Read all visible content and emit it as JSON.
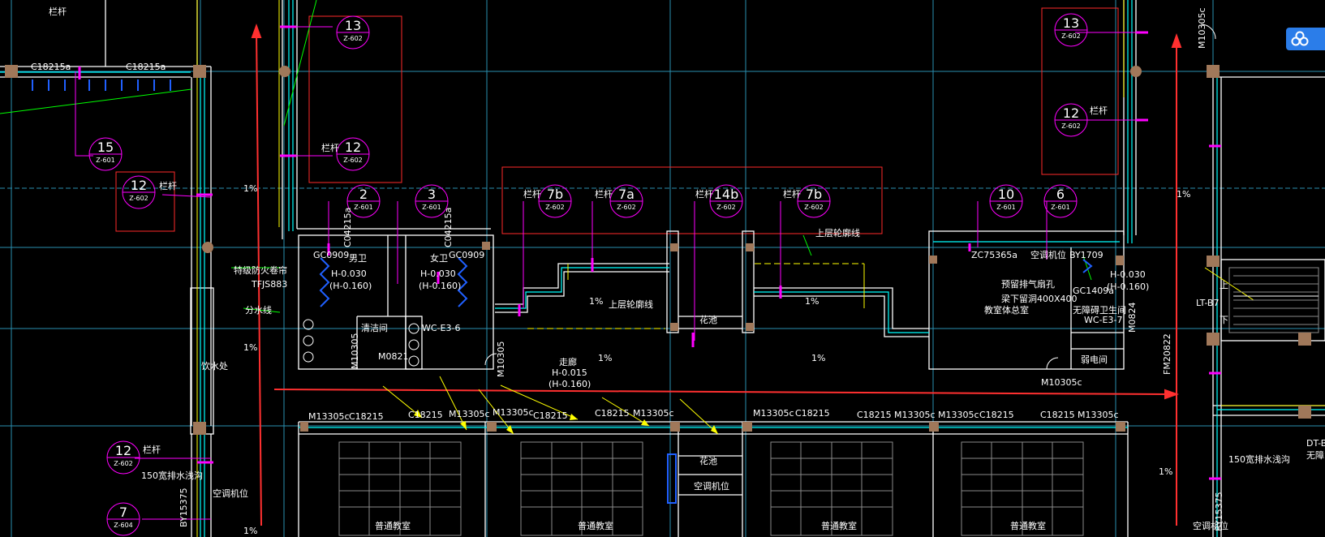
{
  "colors": {
    "background": "#000000",
    "wall": "#ffffff",
    "wall_cyan": "#00ffff",
    "axis": "#2a8fb0",
    "leader": "#ff00ff",
    "detail_frame": "#ff2a2a",
    "yellow": "#ffff00",
    "green": "#00ff00",
    "column": "#a0785a"
  },
  "detail_bubbles": [
    {
      "num": "13",
      "sheet": "Z-602"
    },
    {
      "num": "12",
      "sheet": "Z-602"
    },
    {
      "num": "15",
      "sheet": "Z-601"
    },
    {
      "num": "12",
      "sheet": "Z-602"
    },
    {
      "num": "2",
      "sheet": "Z-601"
    },
    {
      "num": "3",
      "sheet": "Z-601"
    },
    {
      "num": "7b",
      "sheet": "Z-602"
    },
    {
      "num": "7a",
      "sheet": "Z-602"
    },
    {
      "num": "14b",
      "sheet": "Z-602"
    },
    {
      "num": "7b",
      "sheet": "Z-602"
    },
    {
      "num": "10",
      "sheet": "Z-601"
    },
    {
      "num": "6",
      "sheet": "Z-601"
    },
    {
      "num": "13",
      "sheet": "Z-602"
    },
    {
      "num": "12",
      "sheet": "Z-602"
    },
    {
      "num": "12",
      "sheet": "Z-602"
    },
    {
      "num": "7",
      "sheet": "Z-604"
    }
  ],
  "labels": {
    "c18215a_1": "C18215a",
    "c18215a_2": "C18215a",
    "railing_1": "栏杆",
    "railing_2": "栏杆",
    "railing_3": "栏杆",
    "railing_4": "栏杆",
    "railing_5": "栏杆",
    "railing_6": "栏杆",
    "railing_7": "栏杆",
    "railing_8": "栏杆",
    "railing_9": "栏杆",
    "slope_1": "1%",
    "slope_2": "1%",
    "slope_3": "1%",
    "slope_4": "1%",
    "slope_5": "1%",
    "slope_6": "1%",
    "slope_7": "1%",
    "slope_8": "1%",
    "slope_9": "1%",
    "gc0909_1": "GC0909",
    "gc0909_2": "GC0909",
    "c04215a_1": "C04215a",
    "c04215a_2": "C04215a",
    "male_wc": "男卫",
    "female_wc": "女卫",
    "h030_1": "H-0.030",
    "h160_1": "(H-0.160)",
    "h030_2": "H-0.030",
    "h160_2": "(H-0.160)",
    "fire_shutter": "特级防火卷帘",
    "tfjs": "TFJS883",
    "divide_line": "分水线",
    "cleaning_room": "清洁间",
    "wc_e3_6": "WC-E3-6",
    "m10305_1": "M10305",
    "m0821": "M0821",
    "m10305_2": "M10305",
    "drinking": "饮水处",
    "upper_outline_1": "上层轮廓线",
    "upper_outline_2": "上层轮廓线",
    "planter_1": "花池",
    "planter_2": "花池",
    "corridor": "走廊",
    "h015": "H-0.015",
    "h160_3": "(H-0.160)",
    "zc75365a": "ZC75365a",
    "ac_unit_1": "空调机位",
    "bh": "BY1709",
    "exhaust_1": "预留排气扇孔",
    "exhaust_2": "梁下留洞400X400",
    "exhaust_3": "教室体总室",
    "gc1409a": "GC1409a",
    "h030_3": "H-0.030",
    "h160_4": "(H-0.160)",
    "acc_wc": "无障碍卫生间",
    "wc_e3_7": "WC-E3-7",
    "m0824": "M0824",
    "elec_room": "弱电间",
    "fm20822": "FM20822",
    "m10305c": "M10305c",
    "m10305c_top": "M10305c",
    "lt_b7": "LT-B7",
    "up": "上",
    "down": "下",
    "door_1": "M13305c",
    "win_1": "C18215",
    "win_2": "C18215",
    "door_2": "M13305c",
    "door_3": "M13305c",
    "win_3": "C18215",
    "win_4": "C18215",
    "door_4": "M13305c",
    "door_5": "M13305c",
    "win_5": "C18215",
    "win_6": "C18215",
    "door_6": "M13305c",
    "door_7": "M13305c",
    "win_7": "C18215",
    "win_8": "C18215",
    "door_8": "M13305c",
    "ac_unit_2": "空调机位",
    "ac_unit_3": "空调机位",
    "ac_unit_4": "空调机位",
    "drain_1": "150宽排水浅沟",
    "drain_2": "150宽排水浅沟",
    "by15375_1": "BY15375",
    "by15375_2": "BY15375",
    "classroom_1": "普通教室",
    "classroom_2": "普通教室",
    "classroom_3": "普通教室",
    "classroom_4": "普通教室",
    "dt_b": "DT-B",
    "no_barrier": "无障"
  }
}
